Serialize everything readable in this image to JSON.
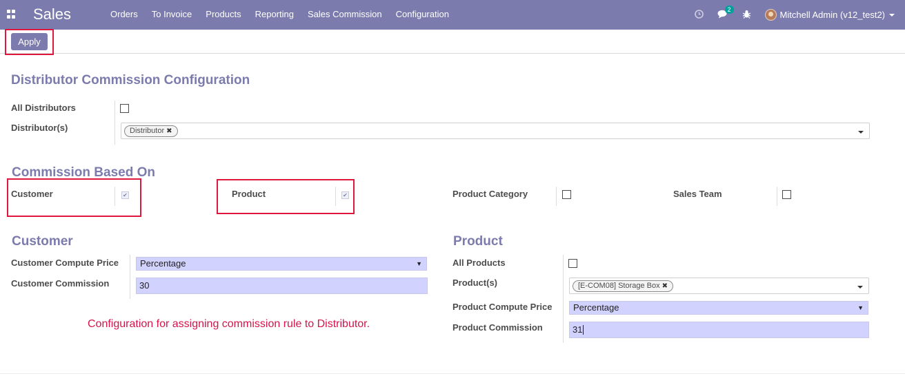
{
  "navbar": {
    "app_name": "Sales",
    "menu": [
      "Orders",
      "To Invoice",
      "Products",
      "Reporting",
      "Sales Commission",
      "Configuration"
    ],
    "chat_badge": "2",
    "user": "Mitchell Admin (v12_test2)",
    "icons": [
      "apps-grid-icon",
      "clock-icon",
      "chat-icon",
      "bug-icon",
      "avatar"
    ]
  },
  "control_panel": {
    "apply_label": "Apply"
  },
  "distributor_section": {
    "title": "Distributor Commission Configuration",
    "all_distributors_label": "All Distributors",
    "all_distributors_checked": false,
    "distributors_label": "Distributor(s)",
    "distributor_tags": [
      "Distributor"
    ]
  },
  "commission_based_on": {
    "title": "Commission Based On",
    "customer_label": "Customer",
    "customer_checked": true,
    "product_label": "Product",
    "product_checked": true,
    "product_category_label": "Product Category",
    "product_category_checked": false,
    "sales_team_label": "Sales Team",
    "sales_team_checked": false
  },
  "customer_section": {
    "title": "Customer",
    "compute_price_label": "Customer Compute Price",
    "compute_price_value": "Percentage",
    "commission_label": "Customer Commission",
    "commission_value": "30"
  },
  "product_section": {
    "title": "Product",
    "all_products_label": "All Products",
    "all_products_checked": false,
    "products_label": "Product(s)",
    "product_tags": [
      "[E-COM08] Storage Box"
    ],
    "compute_price_label": "Product Compute Price",
    "compute_price_value": "Percentage",
    "commission_label": "Product Commission",
    "commission_value": "31"
  },
  "annotation_note": "Configuration for assigning commission rule to Distributor.",
  "colors": {
    "brand": "#7c7bad",
    "highlight": "#e0173d",
    "note": "#d4144a",
    "field_bg": "#d2d2ff",
    "badge": "#00a09d"
  }
}
